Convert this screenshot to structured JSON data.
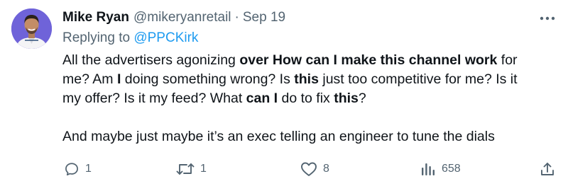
{
  "tweet": {
    "author_name": "Mike Ryan",
    "handle": "@mikeryanretail",
    "separator": "·",
    "date": "Sep 19",
    "replying_prefix": "Replying to ",
    "replying_handle": "@PPCKirk",
    "body": {
      "l1_a": "All the advertisers agonizing ",
      "l1_b": "over How can I make this channel work",
      "l1_c": " for",
      "l2_a": "me? Am ",
      "l2_b": "I",
      "l2_c": " doing something wrong? Is ",
      "l2_d": "this",
      "l2_e": " just too competitive for me? Is it",
      "l3_a": "my offer? Is it my feed? What ",
      "l3_b": "can I",
      "l3_c": " do to fix ",
      "l3_d": "this",
      "l3_e": "?",
      "l4": "And maybe just maybe it’s an exec telling an engineer to tune the dials"
    }
  },
  "actions": {
    "replies": "1",
    "retweets": "1",
    "likes": "8",
    "views": "658"
  },
  "icons": {
    "avatar": "profile-photo",
    "more": "more-dots-icon",
    "reply": "reply-icon",
    "retweet": "retweet-icon",
    "like": "heart-icon",
    "views": "views-icon",
    "share": "share-icon"
  },
  "colors": {
    "text": "#0f1419",
    "secondary": "#536471",
    "link": "#1d9bf0",
    "avatar_bg": "#6f63d9"
  }
}
